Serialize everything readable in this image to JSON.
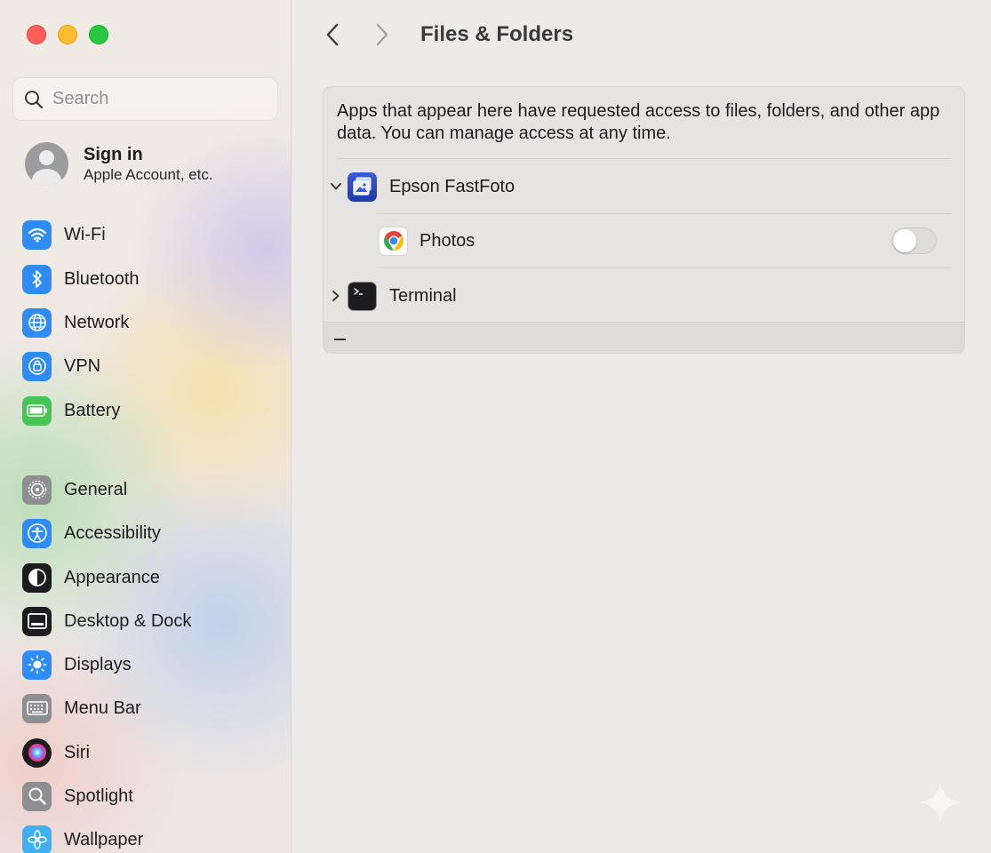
{
  "window": {
    "traffic_lights": {
      "close": "#ff5f57",
      "minimize": "#febc2e",
      "maximize": "#28c840"
    }
  },
  "sidebar": {
    "search": {
      "placeholder": "Search",
      "icon": "magnifier-icon"
    },
    "account": {
      "title": "Sign in",
      "subtitle": "Apple Account, etc.",
      "icon": "person-icon"
    },
    "groups": [
      [
        {
          "label": "Wi-Fi",
          "icon": "wifi-icon",
          "color": "#2f8cf7"
        },
        {
          "label": "Bluetooth",
          "icon": "bluetooth-icon",
          "color": "#2f8cf7"
        },
        {
          "label": "Network",
          "icon": "globe-icon",
          "color": "#2f8cf7"
        },
        {
          "label": "VPN",
          "icon": "vpn-icon",
          "color": "#2f8cf7"
        },
        {
          "label": "Battery",
          "icon": "battery-icon",
          "color": "#45c553"
        }
      ],
      [
        {
          "label": "General",
          "icon": "gear-icon",
          "color": "#8e8e93"
        },
        {
          "label": "Accessibility",
          "icon": "accessibility-icon",
          "color": "#2f8cf7"
        },
        {
          "label": "Appearance",
          "icon": "appearance-icon",
          "color": "#1c1c1e"
        },
        {
          "label": "Desktop & Dock",
          "icon": "dock-icon",
          "color": "#1c1c1e"
        },
        {
          "label": "Displays",
          "icon": "sun-icon",
          "color": "#2f8cf7"
        },
        {
          "label": "Menu Bar",
          "icon": "menubar-icon",
          "color": "#8e8e93"
        },
        {
          "label": "Siri",
          "icon": "siri-icon",
          "color": "#1c1c1e"
        },
        {
          "label": "Spotlight",
          "icon": "magnifier-icon",
          "color": "#8e8e93"
        },
        {
          "label": "Wallpaper",
          "icon": "flower-icon",
          "color": "#3fb0f2"
        }
      ]
    ]
  },
  "main": {
    "title": "Files & Folders",
    "back_icon": "chevron-left-icon",
    "forward_icon": "chevron-right-icon",
    "description": "Apps that appear here have requested access to files, folders, and other app data. You can manage access at any time.",
    "apps": [
      {
        "name": "Epson FastFoto",
        "icon": "photo-app-icon",
        "expanded": true,
        "permissions": [
          {
            "label": "Photos",
            "icon": "chrome-icon",
            "enabled": false
          }
        ]
      },
      {
        "name": "Terminal",
        "icon": "terminal-icon",
        "expanded": false,
        "permissions": []
      }
    ],
    "footer": {
      "remove_label": "−"
    }
  }
}
